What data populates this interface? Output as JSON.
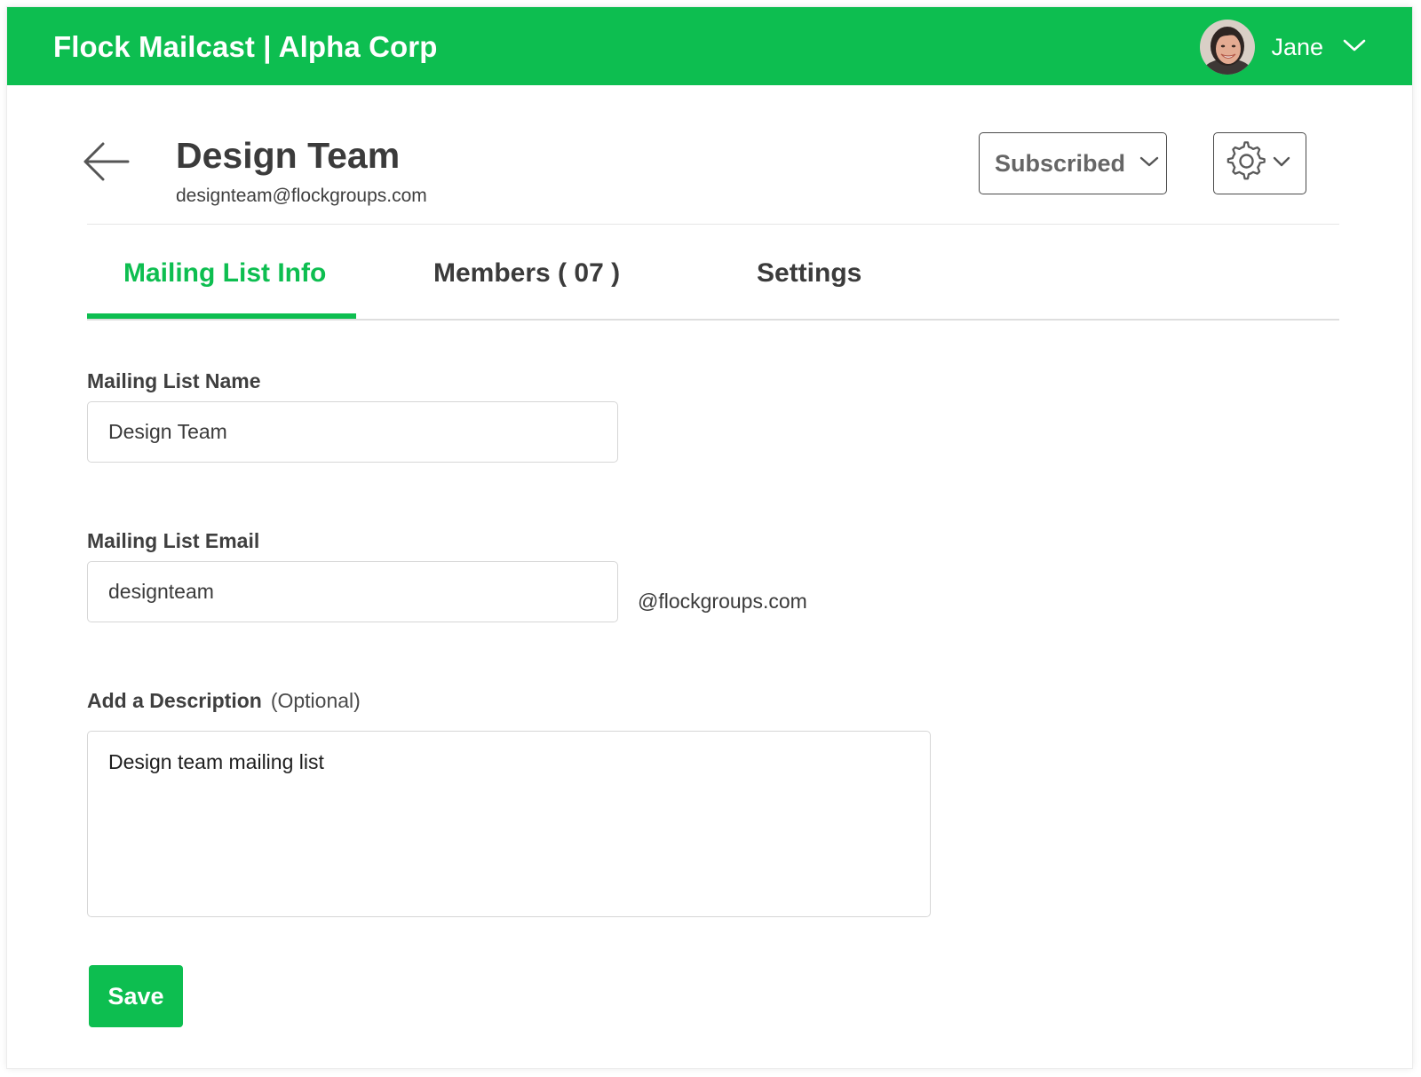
{
  "header": {
    "brand": "Flock Mailcast | Alpha Corp",
    "user_name": "Jane",
    "bg_color": "#0dbe50"
  },
  "page": {
    "title": "Design Team",
    "subtitle": "designteam@flockgroups.com",
    "subscription_label": "Subscribed"
  },
  "tabs": [
    {
      "label": "Mailing List Info",
      "active": true
    },
    {
      "label": "Members ( 07 )",
      "active": false
    },
    {
      "label": "Settings",
      "active": false
    }
  ],
  "form": {
    "name_label": "Mailing List Name",
    "name_value": "Design Team",
    "email_label": "Mailing List Email",
    "email_value": "designteam",
    "email_suffix": "@flockgroups.com",
    "description_label": "Add a Description",
    "description_optional": "(Optional)",
    "description_value": "Design team mailing list",
    "save_label": "Save"
  },
  "icons": {
    "back": "arrow-left-icon",
    "user_menu": "chevron-down-icon",
    "settings": "gear-icon"
  },
  "colors": {
    "accent": "#0dbe50",
    "text_dark": "#3b3b3b"
  }
}
